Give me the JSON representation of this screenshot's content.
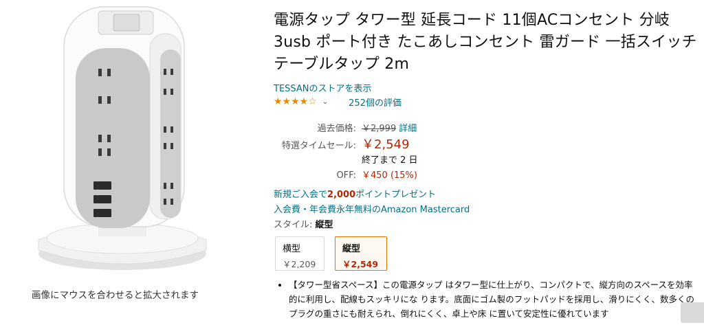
{
  "image_pane": {
    "zoom_hint": "画像にマウスを合わせると拡大されます"
  },
  "product": {
    "title": "電源タップ タワー型 延長コード 11個ACコンセント 分岐 3usb ポート付き たこあしコンセント 雷ガード 一括スイッチ テーブルタップ 2m",
    "store_link": "TESSANのストアを表示",
    "rating_stars": "★★★★☆",
    "rating_value": 4.5,
    "rating_count": "252個の評価"
  },
  "price": {
    "list_label": "過去価格:",
    "list_price": "￥2,999",
    "detail_link": "詳細",
    "sale_label": "特選タイムセール:",
    "sale_price": "￥2,549",
    "countdown": "終了まで 2 日",
    "off_label": "OFF:",
    "off_value": "￥450 (15%)"
  },
  "promos": {
    "line1_pre": "新規ご入会で",
    "line1_points": "2,000",
    "line1_post": "ポイントプレゼント",
    "line2": "入会費・年会費永年無料のAmazon Mastercard"
  },
  "style": {
    "label": "スタイル:",
    "value": "縦型",
    "options": [
      {
        "name": "横型",
        "price": "￥2,209",
        "selected": false
      },
      {
        "name": "縦型",
        "price": "￥2,549",
        "selected": true
      }
    ]
  },
  "bullets": [
    "【タワー型省スペース】この電源タップ はタワー型に仕上がり、コンパクトで、縦方向のスペースを効率的に利用し、配線もスッキリにな ります。底面にゴム製のフットパッドを採用し、滑りにくく、数多くのプラグの重さにも耐えられ、倒れにくく、卓上や床 に置いて安定性に優れています"
  ],
  "colors": {
    "link": "#007185",
    "price_red": "#b12704",
    "star": "#e58a00",
    "selected_border": "#e77600"
  }
}
